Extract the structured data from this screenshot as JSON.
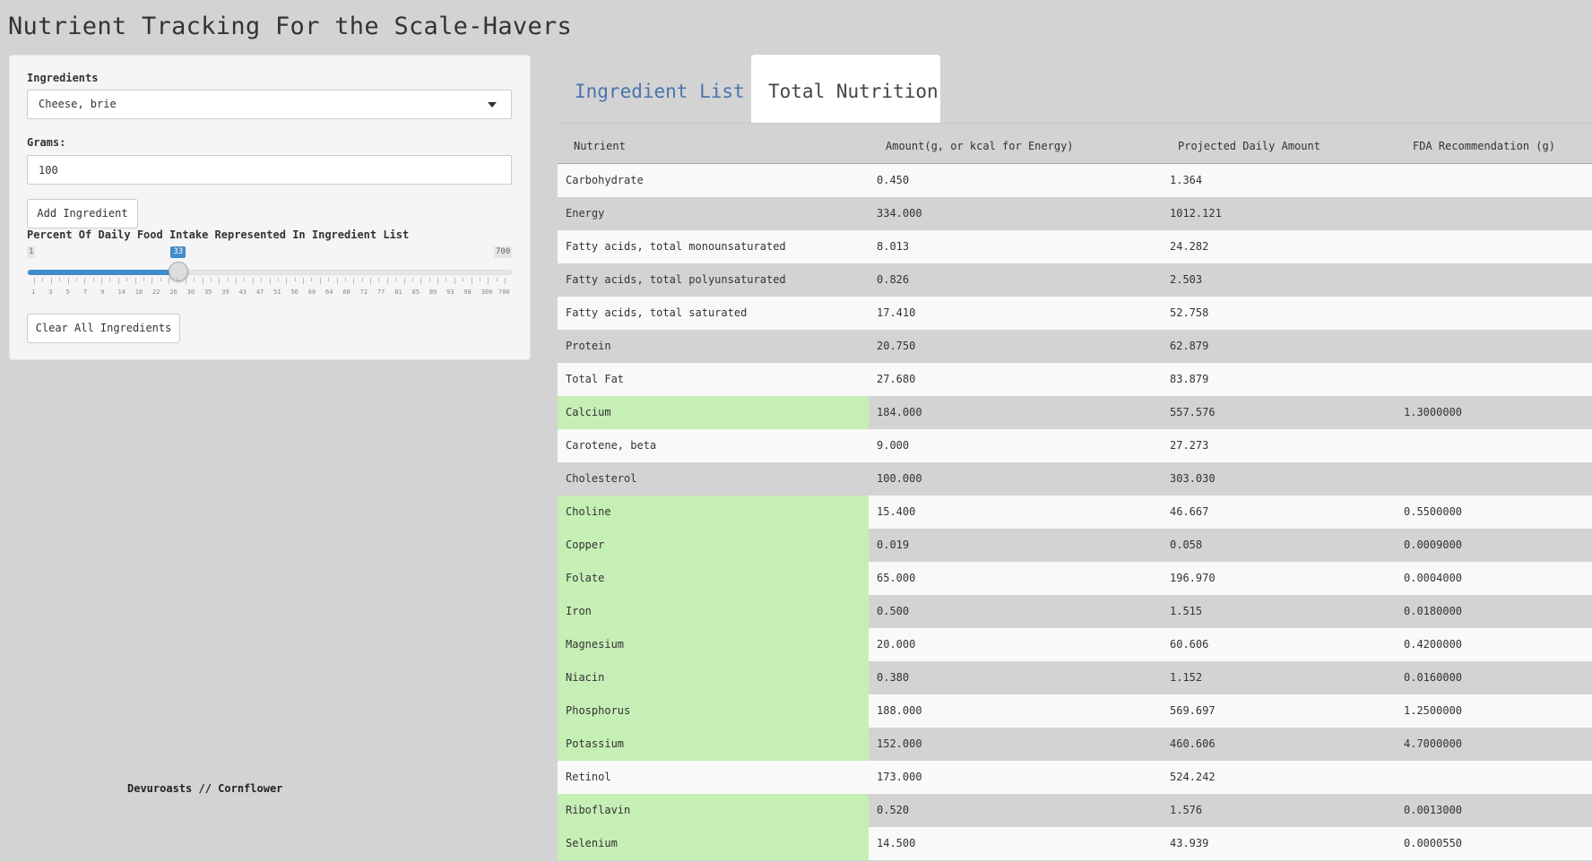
{
  "app": {
    "title": "Nutrient Tracking For the Scale-Havers",
    "footer": "Devuroasts // Cornflower"
  },
  "sidebar": {
    "ingredients_label": "Ingredients",
    "ingredient_selected": "Cheese, brie",
    "grams_label": "Grams:",
    "grams_value": "100",
    "add_button": "Add Ingredient",
    "slider_label": "Percent Of Daily Food Intake Represented In Ingredient List",
    "slider_min": "1",
    "slider_max": "700",
    "slider_value": "33",
    "slider_fraction": 0.313,
    "slider_tick_labels": [
      "1",
      "3",
      "5",
      "7",
      "9",
      "14",
      "18",
      "22",
      "26",
      "30",
      "35",
      "39",
      "43",
      "47",
      "51",
      "56",
      "60",
      "64",
      "68",
      "72",
      "77",
      "81",
      "85",
      "89",
      "93",
      "98",
      "300",
      "700"
    ],
    "clear_button": "Clear All Ingredients"
  },
  "tabs": [
    {
      "label": "Ingredient List",
      "active": false
    },
    {
      "label": "Total Nutrition",
      "active": true
    }
  ],
  "table": {
    "headers": [
      "Nutrient",
      "Amount(g, or kcal for Energy)",
      "Projected Daily Amount",
      "FDA Recommendation (g)"
    ],
    "highlight_color": "#c6efb6",
    "rows": [
      {
        "name": "Carbohydrate",
        "amount": "0.450",
        "projected": "1.364",
        "fda": "",
        "highlight": false
      },
      {
        "name": "Energy",
        "amount": "334.000",
        "projected": "1012.121",
        "fda": "",
        "highlight": false
      },
      {
        "name": "Fatty acids, total monounsaturated",
        "amount": "8.013",
        "projected": "24.282",
        "fda": "",
        "highlight": false
      },
      {
        "name": "Fatty acids, total polyunsaturated",
        "amount": "0.826",
        "projected": "2.503",
        "fda": "",
        "highlight": false
      },
      {
        "name": "Fatty acids, total saturated",
        "amount": "17.410",
        "projected": "52.758",
        "fda": "",
        "highlight": false
      },
      {
        "name": "Protein",
        "amount": "20.750",
        "projected": "62.879",
        "fda": "",
        "highlight": false
      },
      {
        "name": "Total Fat",
        "amount": "27.680",
        "projected": "83.879",
        "fda": "",
        "highlight": false
      },
      {
        "name": "Calcium",
        "amount": "184.000",
        "projected": "557.576",
        "fda": "1.3000000",
        "highlight": true
      },
      {
        "name": "Carotene, beta",
        "amount": "9.000",
        "projected": "27.273",
        "fda": "",
        "highlight": false
      },
      {
        "name": "Cholesterol",
        "amount": "100.000",
        "projected": "303.030",
        "fda": "",
        "highlight": false
      },
      {
        "name": "Choline",
        "amount": "15.400",
        "projected": "46.667",
        "fda": "0.5500000",
        "highlight": true
      },
      {
        "name": "Copper",
        "amount": "0.019",
        "projected": "0.058",
        "fda": "0.0009000",
        "highlight": true
      },
      {
        "name": "Folate",
        "amount": "65.000",
        "projected": "196.970",
        "fda": "0.0004000",
        "highlight": true
      },
      {
        "name": "Iron",
        "amount": "0.500",
        "projected": "1.515",
        "fda": "0.0180000",
        "highlight": true
      },
      {
        "name": "Magnesium",
        "amount": "20.000",
        "projected": "60.606",
        "fda": "0.4200000",
        "highlight": true
      },
      {
        "name": "Niacin",
        "amount": "0.380",
        "projected": "1.152",
        "fda": "0.0160000",
        "highlight": true
      },
      {
        "name": "Phosphorus",
        "amount": "188.000",
        "projected": "569.697",
        "fda": "1.2500000",
        "highlight": true
      },
      {
        "name": "Potassium",
        "amount": "152.000",
        "projected": "460.606",
        "fda": "4.7000000",
        "highlight": true
      },
      {
        "name": "Retinol",
        "amount": "173.000",
        "projected": "524.242",
        "fda": "",
        "highlight": false
      },
      {
        "name": "Riboflavin",
        "amount": "0.520",
        "projected": "1.576",
        "fda": "0.0013000",
        "highlight": true
      },
      {
        "name": "Selenium",
        "amount": "14.500",
        "projected": "43.939",
        "fda": "0.0000550",
        "highlight": true
      }
    ]
  }
}
